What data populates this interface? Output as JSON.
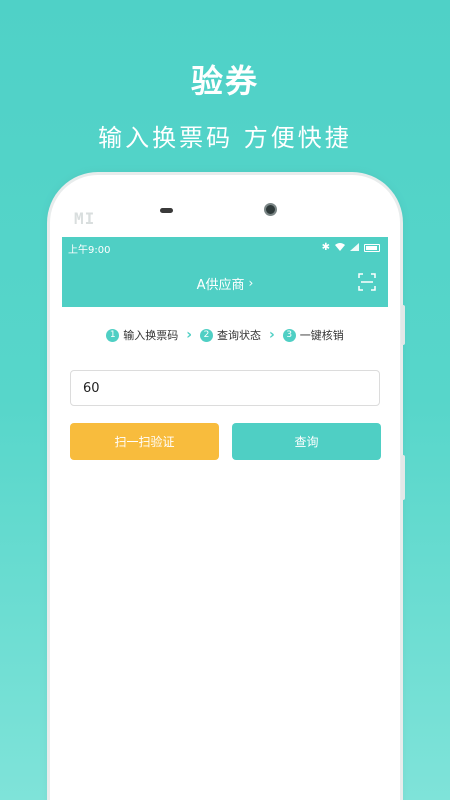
{
  "promo": {
    "title": "验券",
    "subtitle": "输入换票码  方便快捷"
  },
  "device": {
    "brand_logo": "MI"
  },
  "status_bar": {
    "time": "上午9:00",
    "icons": [
      "bluetooth-icon",
      "wifi-icon",
      "signal-icon",
      "battery-icon"
    ]
  },
  "header": {
    "title": "A供应商",
    "title_chevron": "›",
    "scan_icon": "scan-frame-icon"
  },
  "steps": [
    {
      "num": "1",
      "label": "输入换票码"
    },
    {
      "num": "2",
      "label": "查询状态"
    },
    {
      "num": "3",
      "label": "一键核销"
    }
  ],
  "ticket_input": {
    "value": "60",
    "placeholder": ""
  },
  "buttons": {
    "scan_label": "扫一扫验证",
    "query_label": "查询"
  },
  "colors": {
    "primary": "#4fcfc4",
    "accent": "#f8bc3d"
  }
}
